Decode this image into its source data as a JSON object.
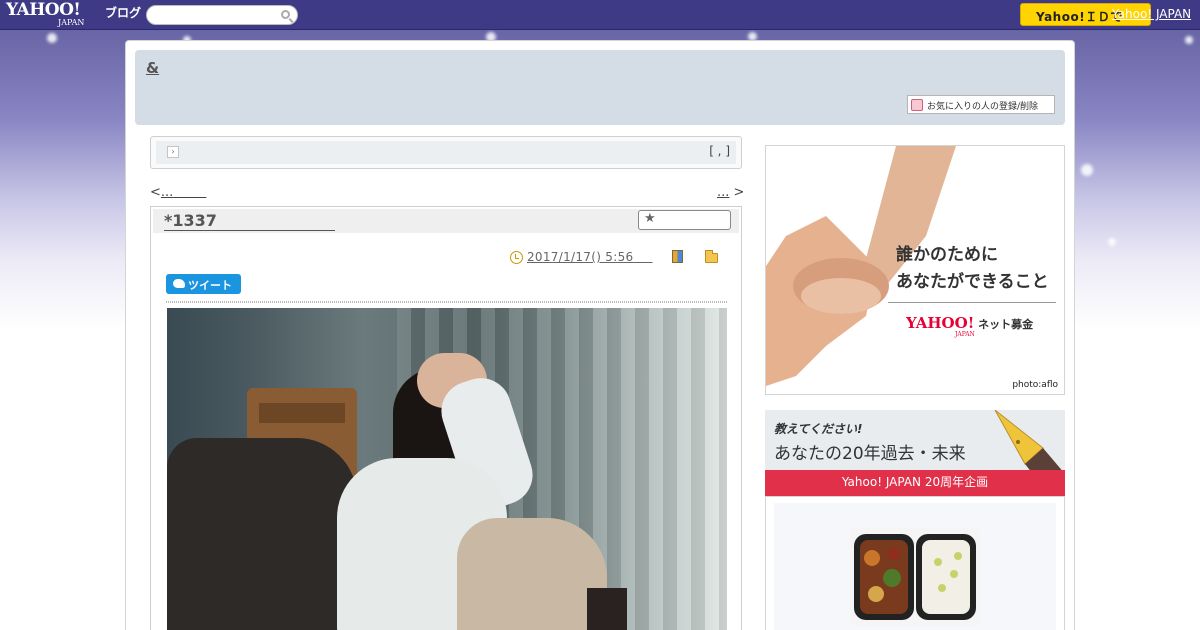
{
  "topbar": {
    "logo_yahoo": "YAHOO!",
    "logo_japan": "JAPAN",
    "logo_blog": "ブログ",
    "search_placeholder": "",
    "yahoo_button": "Yahoo!ＩＤで",
    "yahoo_japan_link": "Yahoo! JAPAN"
  },
  "header": {
    "blog_title": "&",
    "favorite_button": "お気に入りの人の登録/削除"
  },
  "theme_bar": {
    "arrow": "›",
    "bracket": "[ , ]"
  },
  "nav": {
    "prev_symbol": "<",
    "prev_label": "...",
    "next_label": "...",
    "next_symbol": ">"
  },
  "article": {
    "title": "*1337",
    "date": "2017/1/17()  5:56",
    "star_icon": "★",
    "tweet_label": "ツイート"
  },
  "sidebar": {
    "ad1_line1": "誰かのために",
    "ad1_line2": "あなたができること",
    "ad1_brand": "YAHOO!",
    "ad1_brand_japan": "JAPAN",
    "ad1_brand_suffix": "ネット募金",
    "ad1_credit": "photo:aflo",
    "ad2_line1": "教えてください!",
    "ad2_line2": "あなたの20年過去・未来",
    "ad2_footer": "Yahoo! JAPAN 20周年企画"
  },
  "colors": {
    "topbar": "#3e3a86",
    "yahoo_button": "#ffd400",
    "header_bg": "#d4dce6",
    "tweet": "#1b95e0",
    "ad2_banner": "#e0304a"
  }
}
